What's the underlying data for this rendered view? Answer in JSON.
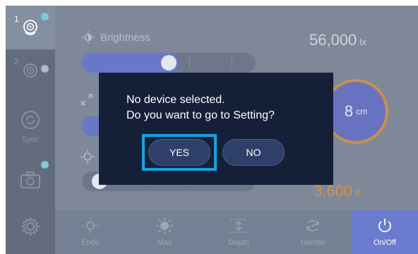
{
  "rail": {
    "items": [
      {
        "num": "1",
        "icon": "endoscope-light-icon",
        "dot_color": "#7ec8d8",
        "active": true
      },
      {
        "num": "2",
        "icon": "endoscope-light-icon",
        "dot_color": "#b2b8c2",
        "active": false
      },
      {
        "num": "",
        "icon": "sync-icon",
        "label": "Sync"
      },
      {
        "num": "",
        "icon": "camera-icon",
        "dot_color": "#7ec8d8"
      },
      {
        "num": "",
        "icon": "gear-icon"
      }
    ]
  },
  "controls": {
    "brightness_label": "Brightness",
    "brightness_level": 0.5,
    "zoom_level": 0.08,
    "color_temp_level": 0.05
  },
  "readings": {
    "illuminance_value": "56,000",
    "illuminance_unit": "lx",
    "distance_value": "8",
    "distance_unit": "cm",
    "color_temp_value": "3,600",
    "color_temp_unit": "K"
  },
  "bottom_bar": {
    "endo": "Endo",
    "max": "Max",
    "depth": "Depth",
    "handle": "Handle",
    "onoff": "On/Off"
  },
  "dialog": {
    "line1": "No device selected.",
    "line2": "Do you want to go to Setting?",
    "yes_label": "YES",
    "no_label": "NO"
  },
  "colors": {
    "accent": "#6a7bd0",
    "focus": "#17a2dd",
    "warm": "#d9914a",
    "dialog_bg": "#152038"
  }
}
